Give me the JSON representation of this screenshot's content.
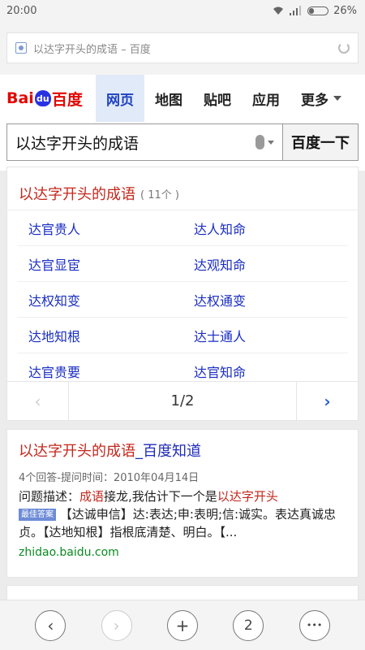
{
  "status": {
    "time": "20:00",
    "battery": "26%"
  },
  "browser": {
    "title": "以达字开头的成语 – 百度"
  },
  "header": {
    "logo": {
      "bai": "Bai",
      "du": "du",
      "cn": "百度"
    },
    "nav": [
      {
        "label": "网页"
      },
      {
        "label": "地图"
      },
      {
        "label": "贴吧"
      },
      {
        "label": "应用"
      }
    ],
    "more": "更多"
  },
  "search": {
    "query": "以达字开头的成语",
    "button": "百度一下"
  },
  "idioms": {
    "title": "以达字开头的成语",
    "count": "( 11个 )",
    "items": [
      "达官贵人",
      "达人知命",
      "达官显宦",
      "达观知命",
      "达权知变",
      "达权通变",
      "达地知根",
      "达士通人",
      "达官贵要",
      "达官知命"
    ],
    "pager": {
      "prev": "‹",
      "page": "1/2",
      "next": "›"
    }
  },
  "result": {
    "title_hl1": "以达字开头的成语",
    "title_rest": "_百度知道",
    "meta": "4个回答-提问时间：2010年04月14日",
    "q_prefix": "问题描述：",
    "q_hl1": "成语",
    "q_mid": "接龙,我估计下一个是",
    "q_hl2": "以达字开头",
    "badge": "最佳答案",
    "answer": "【达诚申信】达:表达;申:表明;信:诚实。表达真诚忠贞。【达地知根】指根底清楚、明白。【...",
    "site": "zhidao.baidu.com"
  },
  "bottom": {
    "back": "‹",
    "forward": "›",
    "new_tab": "+",
    "tabs": "2",
    "menu": "•••"
  }
}
